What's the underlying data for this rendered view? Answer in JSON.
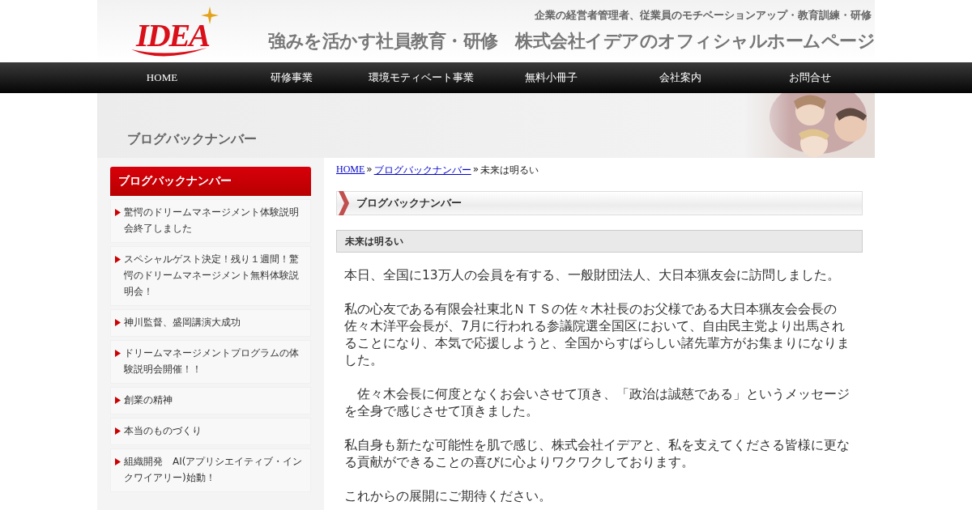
{
  "header": {
    "logo": "IDEA",
    "tagline": "企業の経営者管理者、従業員のモチベーションアップ・教育訓練・研修",
    "title": "強みを活かす社員教育・研修　株式会社イデアのオフィシャルホームページ"
  },
  "nav": [
    {
      "label": "HOME"
    },
    {
      "label": "研修事業"
    },
    {
      "label": "環境モティベート事業"
    },
    {
      "label": "無料小冊子"
    },
    {
      "label": "会社案内"
    },
    {
      "label": "お問合せ"
    }
  ],
  "banner": {
    "title": "ブログバックナンバー"
  },
  "sidebar": {
    "heading": "ブログバックナンバー",
    "items": [
      {
        "label": "驚愕のドリームマネージメント体験説明会終了しました"
      },
      {
        "label": "スペシャルゲスト決定！残り１週間！驚愕のドリームマネージメント無料体験説明会！"
      },
      {
        "label": "神川監督、盛岡講演大成功"
      },
      {
        "label": "ドリームマネージメントプログラムの体験説明会開催！！"
      },
      {
        "label": "創業の精神"
      },
      {
        "label": "本当のものづくり"
      },
      {
        "label": "組織開発　AI(アプリシエイティブ・インクワイアリー)始動！"
      }
    ]
  },
  "breadcrumb_separator": "»",
  "breadcrumb": [
    {
      "label": "HOME",
      "link": true
    },
    {
      "label": "ブログバックナンバー",
      "link": true
    },
    {
      "label": "未来は明るい",
      "link": false
    }
  ],
  "section_title": "ブログバックナンバー",
  "post": {
    "title": "未来は明るい",
    "paragraphs": [
      "本日、全国に13万人の会員を有する、一般財団法人、大日本猟友会に訪問しました。",
      "私の心友である有限会社東北ＮＴＳの佐々木社長のお父様である大日本猟友会会長の佐々木洋平会長が、7月に行われる参議院選全国区において、自由民主党より出馬されることになり、本気で応援しようと、全国からすばらしい諸先輩方がお集まりになりました。",
      "　佐々木会長に何度となくお会いさせて頂き、「政治は誠慈である」というメッセージを全身で感じさせて頂きました。",
      "私自身も新たな可能性を肌で感じ、株式会社イデアと、私を支えてくださる皆様に更なる貢献ができることの喜びに心よりワクワクしております。",
      "これからの展開にご期待ください。"
    ]
  }
}
